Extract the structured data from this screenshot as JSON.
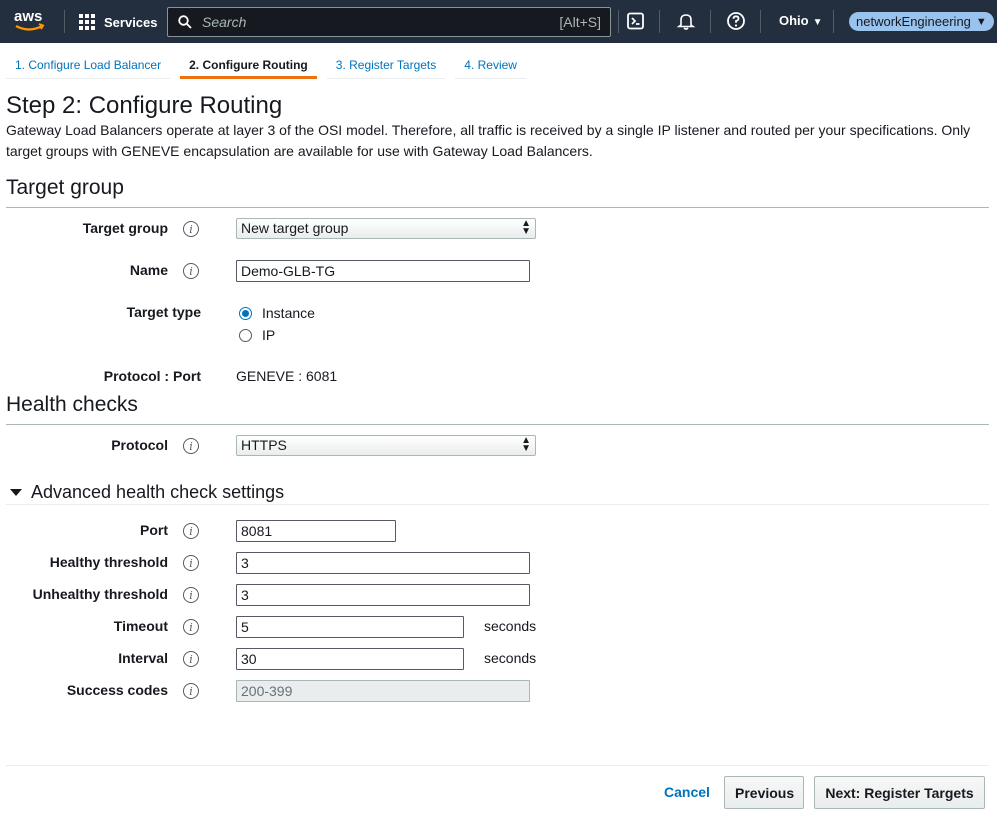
{
  "header": {
    "logo_text": "aws",
    "services_label": "Services",
    "search_placeholder": "Search",
    "search_shortcut": "[Alt+S]",
    "region": "Ohio",
    "account": "networkEngineering"
  },
  "tabs": [
    {
      "label": "1. Configure Load Balancer",
      "active": false
    },
    {
      "label": "2. Configure Routing",
      "active": true
    },
    {
      "label": "3. Register Targets",
      "active": false
    },
    {
      "label": "4. Review",
      "active": false
    }
  ],
  "page": {
    "title": "Step 2: Configure Routing",
    "description": "Gateway Load Balancers operate at layer 3 of the OSI model. Therefore, all traffic is received by a single IP listener and routed per your specifications. Only target groups with GENEVE encapsulation are available for use with Gateway Load Balancers."
  },
  "target_group": {
    "section_title": "Target group",
    "target_group_label": "Target group",
    "target_group_value": "New target group",
    "name_label": "Name",
    "name_value": "Demo-GLB-TG",
    "target_type_label": "Target type",
    "target_type_options": [
      {
        "label": "Instance",
        "checked": true
      },
      {
        "label": "IP",
        "checked": false
      }
    ],
    "protocol_port_label": "Protocol : Port",
    "protocol_port_value": "GENEVE : 6081"
  },
  "health_checks": {
    "section_title": "Health checks",
    "protocol_label": "Protocol",
    "protocol_value": "HTTPS",
    "advanced_title": "Advanced health check settings",
    "port_label": "Port",
    "port_value": "8081",
    "healthy_label": "Healthy threshold",
    "healthy_value": "3",
    "unhealthy_label": "Unhealthy threshold",
    "unhealthy_value": "3",
    "timeout_label": "Timeout",
    "timeout_value": "5",
    "timeout_unit": "seconds",
    "interval_label": "Interval",
    "interval_value": "30",
    "interval_unit": "seconds",
    "success_label": "Success codes",
    "success_value": "200-399"
  },
  "footer": {
    "cancel": "Cancel",
    "previous": "Previous",
    "next": "Next: Register Targets"
  },
  "colors": {
    "nav_bg": "#232f3e",
    "link": "#0073bb",
    "active_tab_accent": "#ec7211",
    "account_badge": "#99c2ec"
  },
  "icons": [
    "aws-logo",
    "grid-icon",
    "search-icon",
    "cloudshell-icon",
    "bell-icon",
    "help-icon",
    "info-icon",
    "caret-down-icon"
  ]
}
